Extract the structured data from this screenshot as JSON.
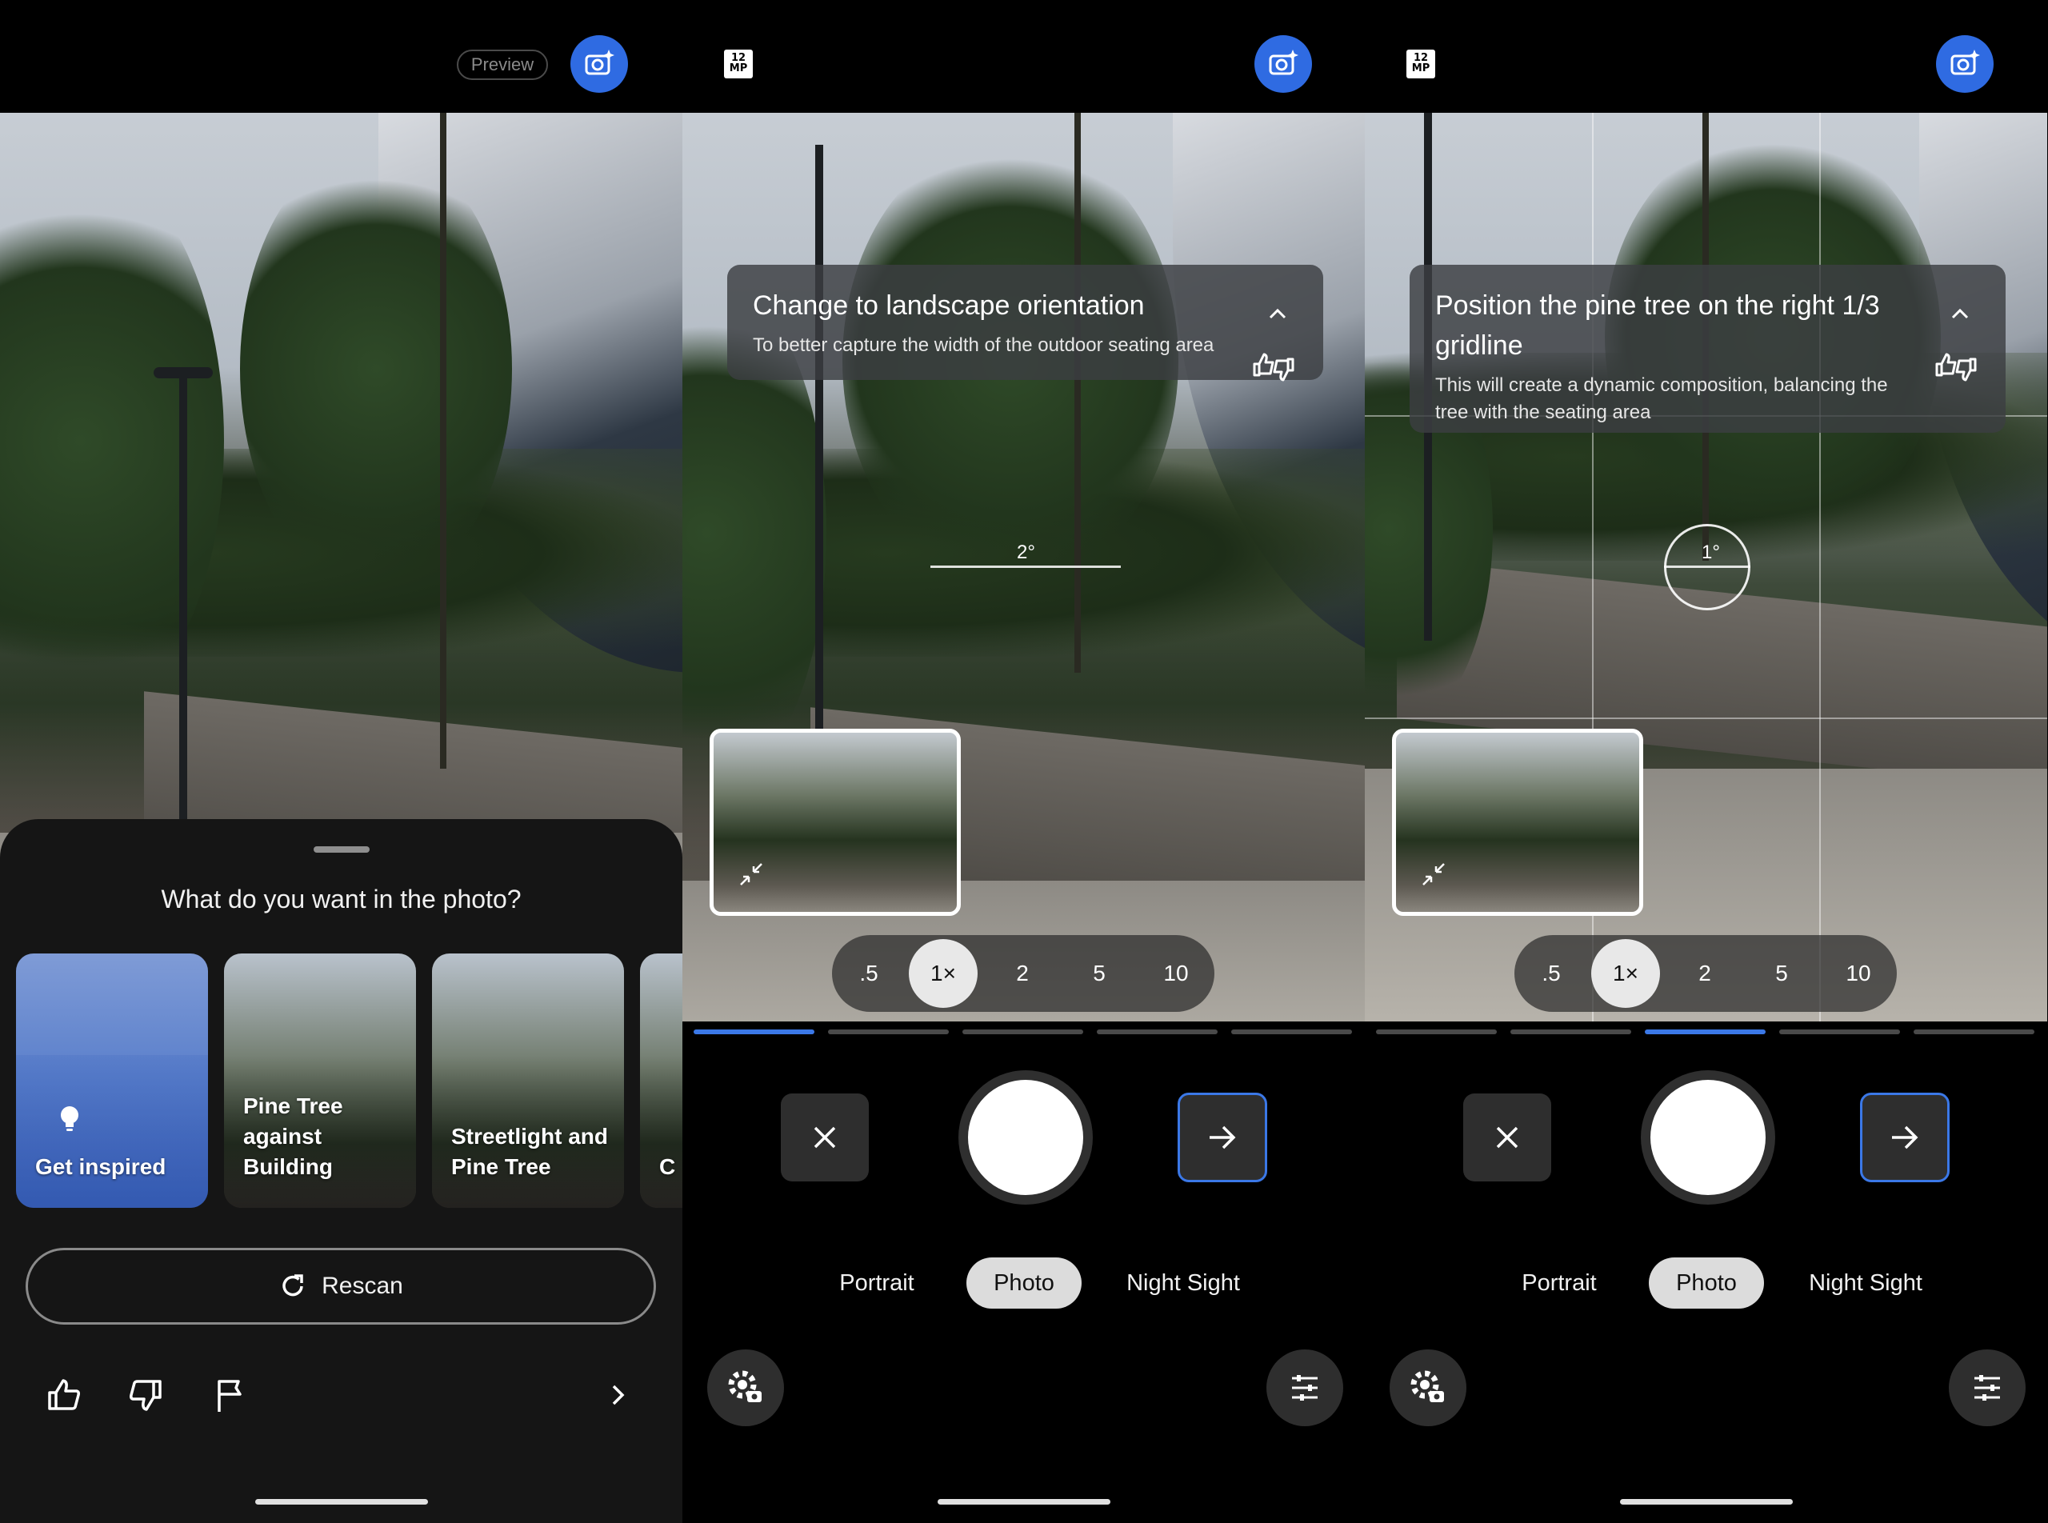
{
  "panel1": {
    "preview_label": "Preview",
    "sheet_title": "What do you want in the photo?",
    "cards": [
      {
        "label": "Get inspired",
        "icon": "lightbulb-icon"
      },
      {
        "label": "Pine Tree against Building"
      },
      {
        "label": "Streetlight and Pine Tree"
      },
      {
        "label": "C"
      }
    ],
    "rescan_label": "Rescan"
  },
  "panel2": {
    "mp_badge": "12 MP",
    "suggestion_title": "Change to landscape orientation",
    "suggestion_body": "To better capture the width of the outdoor seating area",
    "level_label": "2°",
    "zoom": [
      ".5",
      "1×",
      "2",
      "5",
      "10"
    ],
    "modes": [
      "Portrait",
      "Photo",
      "Night Sight"
    ]
  },
  "panel3": {
    "mp_badge": "12 MP",
    "suggestion_title": "Position the pine tree on the right 1/3 gridline",
    "suggestion_body": "This will create a dynamic composition, balancing the tree with the seating area",
    "level_label": "1°",
    "zoom": [
      ".5",
      "1×",
      "2",
      "5",
      "10"
    ],
    "modes": [
      "Portrait",
      "Photo",
      "Night Sight"
    ]
  },
  "colors": {
    "accent_blue": "#3b78e7",
    "ai_button_blue": "#2f6be2",
    "background": "#000000",
    "sheet": "#151515"
  }
}
